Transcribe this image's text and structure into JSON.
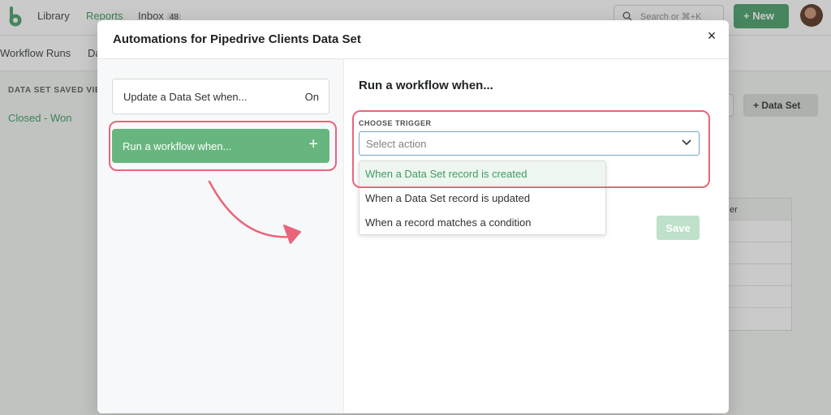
{
  "app": {
    "nav": {
      "library": "Library",
      "reports": "Reports",
      "inbox": "Inbox",
      "inbox_count": "48"
    },
    "search_placeholder": "Search or ⌘+K",
    "new_button": "New",
    "subnav": {
      "workflow_runs": "Workflow Runs",
      "partial_tab": "Da"
    },
    "left_section_title": "DATA SET SAVED VIEW",
    "left_link": "Closed - Won",
    "add_dataset_button": "Data Set",
    "table_header_partial": "er"
  },
  "modal": {
    "title": "Automations for Pipedrive Clients Data Set",
    "close_glyph": "×",
    "triggers": [
      {
        "label": "Update a Data Set when...",
        "state": "On"
      },
      {
        "label": "Run a workflow when...",
        "action_glyph": "+"
      }
    ],
    "right": {
      "heading": "Run a workflow when...",
      "field_label": "CHOOSE TRIGGER",
      "select_placeholder": "Select action",
      "options": [
        "When a Data Set record is created",
        "When a Data Set record is updated",
        "When a record matches a condition"
      ],
      "save_button": "Save"
    }
  },
  "colors": {
    "brand_green": "#4aa06b",
    "selected_card": "#67b67f",
    "highlight_annotation": "#e8657a",
    "focus_border": "#6fa6c9"
  },
  "icons": [
    "logo-icon",
    "search-icon",
    "plus-icon",
    "avatar",
    "close-icon",
    "chevron-down-icon",
    "annotation-arrow"
  ]
}
